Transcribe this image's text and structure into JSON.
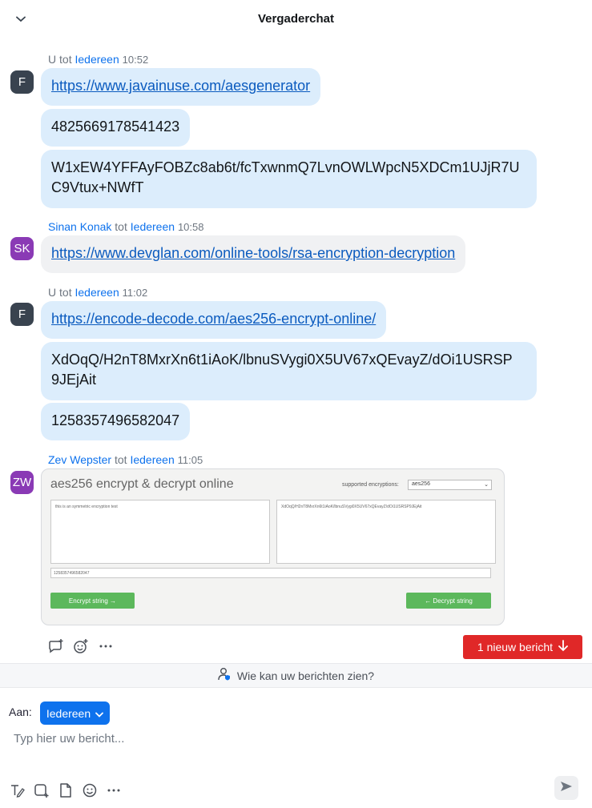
{
  "header": {
    "title": "Vergaderchat"
  },
  "messages": [
    {
      "sender": "U",
      "to_word": "tot",
      "recipient": "Iedereen",
      "time": "10:52",
      "avatar": "F",
      "items": [
        "https://www.javainuse.com/aesgenerator",
        "4825669178541423",
        "W1xEW4YFFAyFOBZc8ab6t/fcTxwnmQ7LvnOWLWpcN5XDCm1UJjR7U",
        "C9Vtux+NWfT"
      ]
    },
    {
      "sender": "Sinan Konak",
      "to_word": "tot",
      "recipient": "Iedereen",
      "time": "10:58",
      "avatar": "SK",
      "items": [
        "https://www.devglan.com/online-tools/rsa-encryption-decryption"
      ]
    },
    {
      "sender": "U",
      "to_word": "tot",
      "recipient": "Iedereen",
      "time": "11:02",
      "avatar": "F",
      "items": [
        "https://encode-decode.com/aes256-encrypt-online/",
        "XdOqQ/H2nT8MxrXn6t1iAoK/lbnuSVygi0X5UV67xQEvayZ/dOi1USRSP",
        "9JEjAit",
        "1258357496582047"
      ]
    },
    {
      "sender": "Zev Wepster",
      "to_word": "tot",
      "recipient": "Iedereen",
      "time": "11:05",
      "avatar": "ZW",
      "image": {
        "title": "aes256 encrypt & decrypt online",
        "supported_label": "supported encryptions:",
        "select_value": "aes256",
        "left_text": "this is an symmetric encryption test",
        "right_text": "XdOqQ/H2nT8MxrXn6t1iAoK/lbnuSVygi0X5UV67xQEvayZ/dOi1USRSP9JEjAit",
        "key_text": "1258357496582047",
        "encrypt_btn": "Encrypt string →",
        "decrypt_btn": "← Decrypt string"
      }
    }
  ],
  "new_message": {
    "label": "1 nieuw bericht"
  },
  "privacy": {
    "label": "Wie kan uw berichten zien?"
  },
  "composer": {
    "to_label": "Aan:",
    "to_value": "Iedereen",
    "placeholder": "Typ hier uw bericht..."
  },
  "colors": {
    "accent": "#0e72ed",
    "bubble": "#dcedfc",
    "alert": "#e02828",
    "avatar_purple": "#8a3ab5",
    "avatar_dark": "#39434f"
  }
}
